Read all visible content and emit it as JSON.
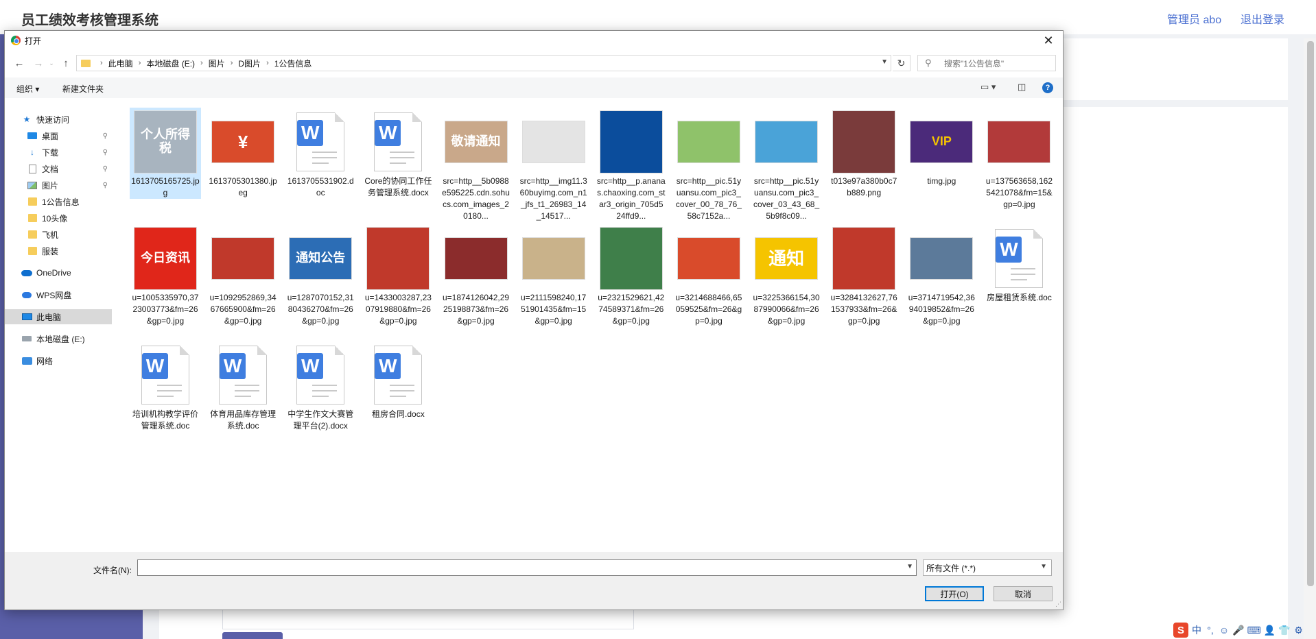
{
  "app": {
    "title": "员工绩效考核管理系统",
    "user": "管理员 abo",
    "logout": "退出登录"
  },
  "dialog": {
    "title": "打开",
    "close": "✕",
    "breadcrumb": [
      "此电脑",
      "本地磁盘 (E:)",
      "图片",
      "D图片",
      "1公告信息"
    ],
    "search_placeholder": "搜索\"1公告信息\"",
    "toolbar": {
      "organize": "组织 ▾",
      "new_folder": "新建文件夹"
    },
    "nav": [
      {
        "label": "快速访问",
        "icon": "star-icon",
        "pinned": false,
        "indent": 1
      },
      {
        "label": "桌面",
        "icon": "desktop-icon",
        "pinned": true,
        "indent": 2
      },
      {
        "label": "下载",
        "icon": "download-icon",
        "pinned": true,
        "indent": 2
      },
      {
        "label": "文档",
        "icon": "document-icon",
        "pinned": true,
        "indent": 2
      },
      {
        "label": "图片",
        "icon": "pictures-icon",
        "pinned": true,
        "indent": 2
      },
      {
        "label": "1公告信息",
        "icon": "folder-icon",
        "pinned": false,
        "indent": 2
      },
      {
        "label": "10头像",
        "icon": "folder-icon",
        "pinned": false,
        "indent": 2
      },
      {
        "label": "飞机",
        "icon": "folder-icon",
        "pinned": false,
        "indent": 2
      },
      {
        "label": "服装",
        "icon": "folder-icon",
        "pinned": false,
        "indent": 2
      },
      {
        "label": "OneDrive",
        "icon": "onedrive-icon",
        "pinned": false,
        "indent": 1
      },
      {
        "label": "WPS网盘",
        "icon": "wps-cloud-icon",
        "pinned": false,
        "indent": 1
      },
      {
        "label": "此电脑",
        "icon": "computer-icon",
        "pinned": false,
        "indent": 1,
        "selected": true
      },
      {
        "label": "本地磁盘 (E:)",
        "icon": "drive-icon",
        "pinned": false,
        "indent": 1
      },
      {
        "label": "网络",
        "icon": "network-icon",
        "pinned": false,
        "indent": 1
      }
    ],
    "files": [
      {
        "name": "1613705165725.jpg",
        "kind": "image",
        "color": "#a8b4bf",
        "caption": "个人所得税",
        "selected": true
      },
      {
        "name": "1613705301380.jpeg",
        "kind": "image",
        "color": "#d94b2b",
        "caption": "¥"
      },
      {
        "name": "1613705531902.doc",
        "kind": "doc"
      },
      {
        "name": "Core的协同工作任务管理系统.docx",
        "kind": "doc"
      },
      {
        "name": "src=http__5b0988e595225.cdn.sohucs.com_images_20180...",
        "kind": "image",
        "color": "#c9a88a",
        "caption": "敬请通知"
      },
      {
        "name": "src=http__img11.360buyimg.com_n1_jfs_t1_26983_14_14517...",
        "kind": "image",
        "color": "#e4e4e4",
        "caption": ""
      },
      {
        "name": "src=http__p.ananas.chaoxing.com_star3_origin_705d524ffd9...",
        "kind": "image",
        "color": "#0b4d9c",
        "caption": ""
      },
      {
        "name": "src=http__pic.51yuansu.com_pic3_cover_00_78_76_58c7152a...",
        "kind": "image",
        "color": "#8fc26a",
        "caption": ""
      },
      {
        "name": "src=http__pic.51yuansu.com_pic3_cover_03_43_68_5b9f8c09...",
        "kind": "image",
        "color": "#4aa3d8",
        "caption": ""
      },
      {
        "name": "t013e97a380b0c7b889.png",
        "kind": "image",
        "color": "#7a3b3b",
        "caption": ""
      },
      {
        "name": "timg.jpg",
        "kind": "image",
        "color": "#4b2a7a",
        "caption": "VIP"
      },
      {
        "name": "u=137563658,1625421078&fm=15&gp=0.jpg",
        "kind": "image",
        "color": "#b23a3a",
        "caption": ""
      },
      {
        "name": "u=1005335970,3723003773&fm=26&gp=0.jpg",
        "kind": "image",
        "color": "#e0261a",
        "caption": "今日资讯"
      },
      {
        "name": "u=1092952869,3467665900&fm=26&gp=0.jpg",
        "kind": "image",
        "color": "#c0392b",
        "caption": ""
      },
      {
        "name": "u=1287070152,3180436270&fm=26&gp=0.jpg",
        "kind": "image",
        "color": "#2c6db5",
        "caption": "通知公告"
      },
      {
        "name": "u=1433003287,2307919880&fm=26&gp=0.jpg",
        "kind": "image",
        "color": "#c0392b",
        "caption": ""
      },
      {
        "name": "u=1874126042,2925198873&fm=26&gp=0.jpg",
        "kind": "image",
        "color": "#8b2c2c",
        "caption": ""
      },
      {
        "name": "u=2111598240,1751901435&fm=15&gp=0.jpg",
        "kind": "image",
        "color": "#c9b28a",
        "caption": ""
      },
      {
        "name": "u=2321529621,4274589371&fm=26&gp=0.jpg",
        "kind": "image",
        "color": "#3f7f4a",
        "caption": ""
      },
      {
        "name": "u=3214688466,65059525&fm=26&gp=0.jpg",
        "kind": "image",
        "color": "#d94b2b",
        "caption": ""
      },
      {
        "name": "u=3225366154,3087990066&fm=26&gp=0.jpg",
        "kind": "image",
        "color": "#f5c400",
        "caption": "通知"
      },
      {
        "name": "u=3284132627,761537933&fm=26&gp=0.jpg",
        "kind": "image",
        "color": "#c0392b",
        "caption": ""
      },
      {
        "name": "u=3714719542,3694019852&fm=26&gp=0.jpg",
        "kind": "image",
        "color": "#5c7a9a",
        "caption": ""
      },
      {
        "name": "房屋租赁系统.doc",
        "kind": "doc"
      },
      {
        "name": "培训机构教学评价管理系统.doc",
        "kind": "doc"
      },
      {
        "name": "体育用品库存管理系统.doc",
        "kind": "doc"
      },
      {
        "name": "中学生作文大赛管理平台(2).docx",
        "kind": "doc"
      },
      {
        "name": "租房合同.docx",
        "kind": "doc"
      }
    ],
    "filename_label": "文件名(N):",
    "filename_value": "",
    "filetype": "所有文件 (*.*)",
    "open_button": "打开(O)",
    "cancel_button": "取消"
  },
  "tray": [
    "中",
    "°,",
    "☺",
    "🎤",
    "⌨",
    "👤",
    "👕",
    "⚙"
  ],
  "tray_logo": "S"
}
